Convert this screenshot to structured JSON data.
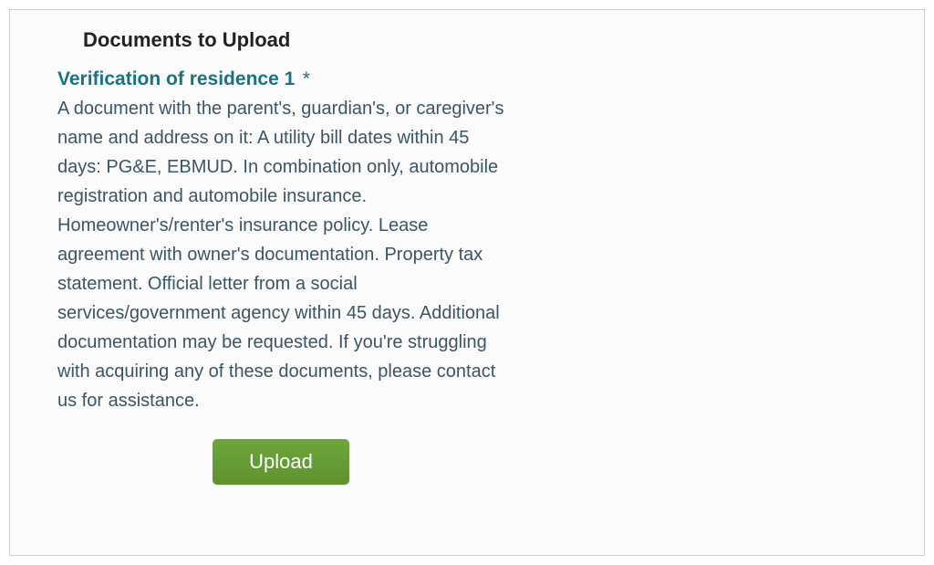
{
  "heading": "Documents to Upload",
  "field": {
    "label": "Verification of residence 1",
    "required_mark": "*",
    "description": "A document with the parent's, guardian's, or caregiver's name and address on it: A utility bill dates within 45 days: PG&E, EBMUD. In combination only, automobile registration and automobile insurance. Homeowner's/renter's insurance policy. Lease agreement with owner's documentation. Property tax statement. Official letter from a social services/government agency within 45 days. Additional documentation may be requested. If you're struggling with acquiring any of these documents, please contact us for assistance."
  },
  "upload_button_label": "Upload"
}
